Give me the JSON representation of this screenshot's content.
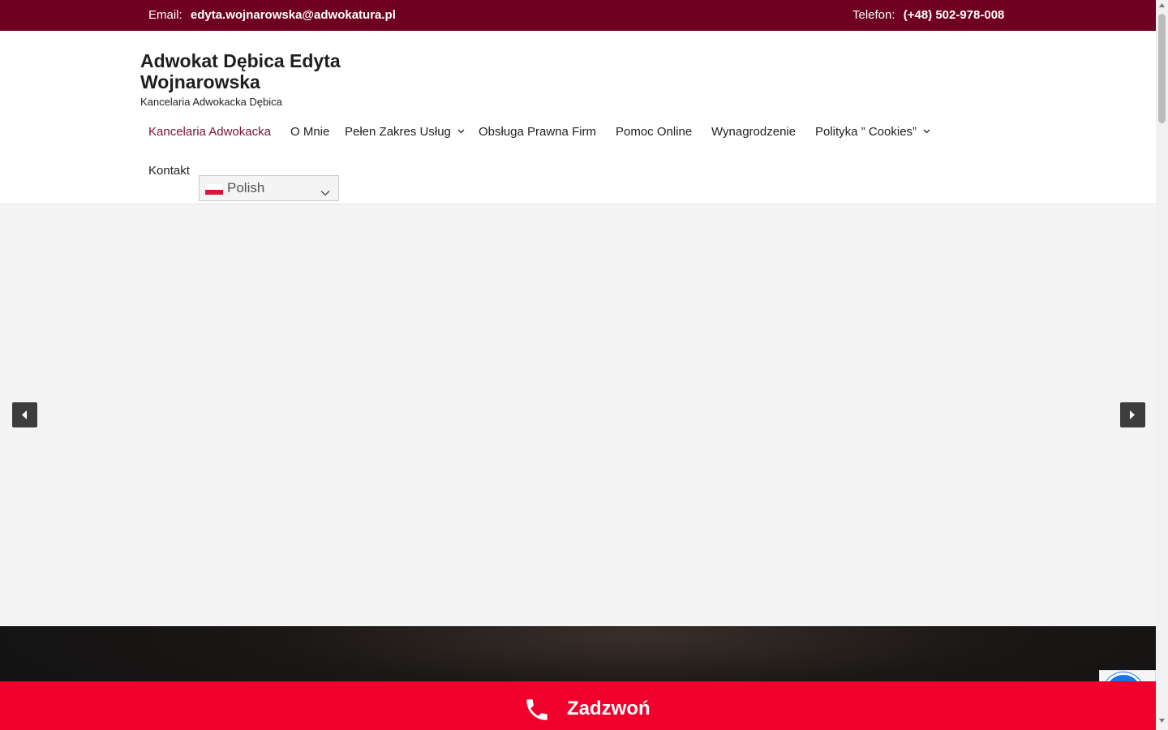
{
  "topbar": {
    "email_label": "Email:",
    "email_value": "edyta.wojnarowska@adwokatura.pl",
    "phone_label": "Telefon:",
    "phone_value": "(+48) 502-978-008"
  },
  "header": {
    "title": "Adwokat Dębica Edyta Wojnarowska",
    "tagline": "Kancelaria Adwokacka Dębica"
  },
  "nav": {
    "items": [
      {
        "label": "Kancelaria Adwokacka",
        "active": true,
        "dropdown": false
      },
      {
        "label": "O Mnie",
        "active": false,
        "dropdown": false
      },
      {
        "label": "Pełen Zakres Usług",
        "active": false,
        "dropdown": true
      },
      {
        "label": "Obsługa Prawna Firm",
        "active": false,
        "dropdown": false
      },
      {
        "label": "Pomoc Online",
        "active": false,
        "dropdown": false
      },
      {
        "label": "Wynagrodzenie",
        "active": false,
        "dropdown": false
      },
      {
        "label": "Polityka ” Cookies”",
        "active": false,
        "dropdown": true
      },
      {
        "label": "Kontakt",
        "active": false,
        "dropdown": false
      }
    ]
  },
  "language": {
    "selected": "Polish",
    "flag": "poland-flag-icon"
  },
  "slider": {
    "prev_icon": "caret-left-icon",
    "next_icon": "caret-right-icon"
  },
  "callbar": {
    "label": "Zadzwoń",
    "icon": "phone-icon"
  },
  "colors": {
    "topbar_bg": "#6f0022",
    "accent": "#7a1232",
    "callbar_bg": "#f0002a",
    "slider_bg": "#f4f4f4"
  }
}
